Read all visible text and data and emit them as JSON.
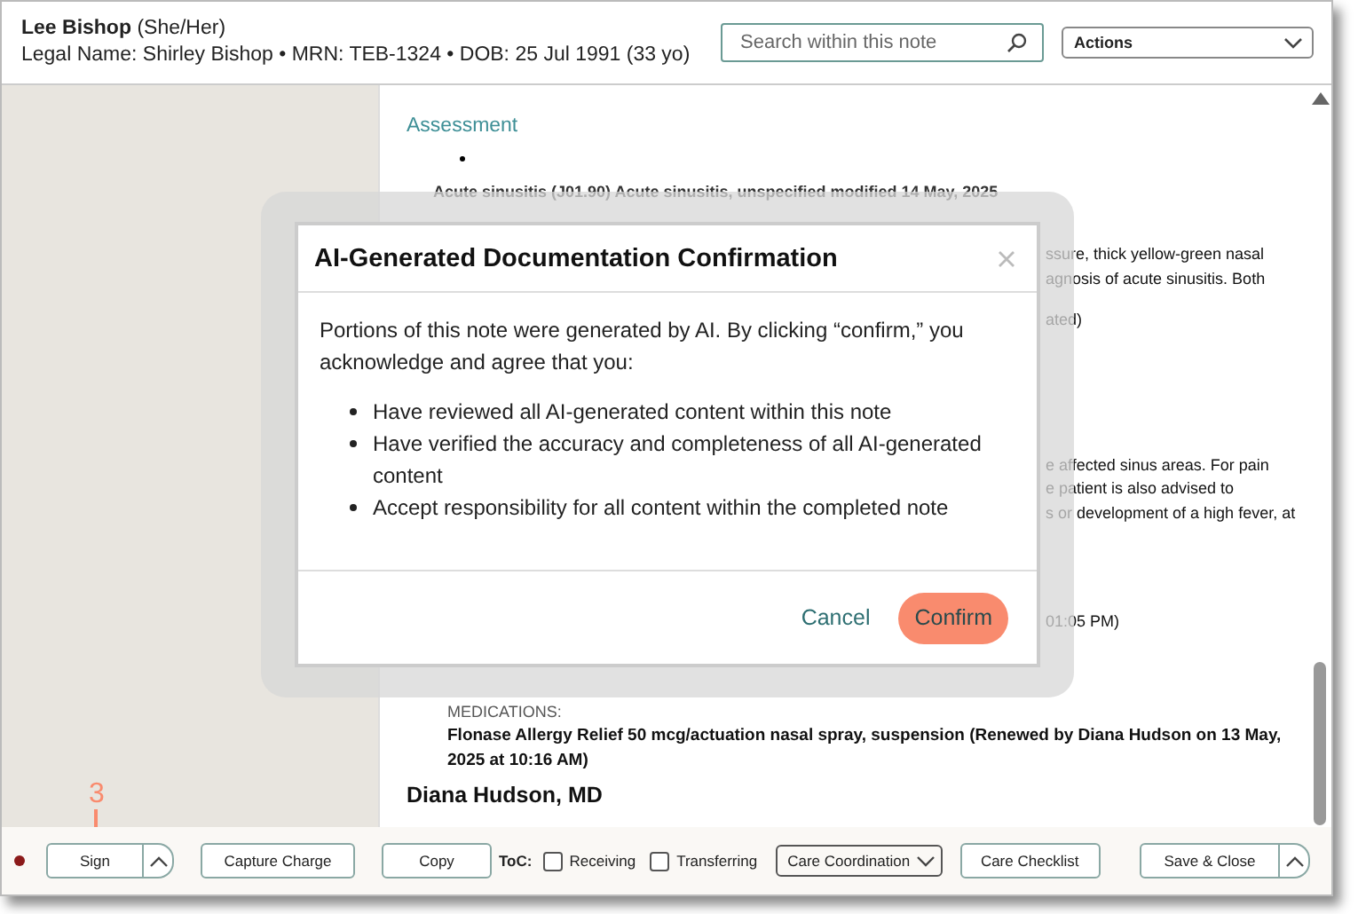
{
  "patient": {
    "name": "Lee Bishop",
    "pronouns": "(She/Her)",
    "details": "Legal Name: Shirley Bishop • MRN: TEB-1324 • DOB: 25 Jul 1991 (33 yo)"
  },
  "search": {
    "placeholder": "Search within this note"
  },
  "actions_dropdown": {
    "value": "Actions"
  },
  "note": {
    "section_heading": "Assessment",
    "diagnosis": "Acute sinusitis (J01.90) Acute sinusitis, unspecified modified 14 May, 2025",
    "fragments": [
      {
        "lines": [
          "ssure, thick yellow-green nasal",
          "agnosis of acute sinusitis. Both"
        ]
      },
      {
        "lines": [
          "ated)"
        ]
      },
      {
        "lines": [
          "e affected sinus areas. For pain",
          "e patient is also advised to",
          "s or development of a high fever, at"
        ]
      },
      {
        "lines": [
          "01:05 PM)"
        ]
      }
    ],
    "medications_label": "MEDICATIONS:",
    "medication": "Flonase Allergy Relief 50 mcg/actuation nasal spray, suspension (Renewed by Diana Hudson on 13 May, 2025 at 10:16 AM)",
    "signature": "Diana Hudson, MD"
  },
  "dialog": {
    "title": "AI-Generated Documentation Confirmation",
    "intro": "Portions of this note were generated by AI. By clicking “confirm,” you acknowledge and agree that you:",
    "points": [
      "Have reviewed all AI-generated content within this note",
      "Have verified the accuracy and completeness of all AI-generated content",
      "Accept responsibility for all content within the completed note"
    ],
    "buttons": [
      {
        "label": "Cancel",
        "kind": "link"
      },
      {
        "label": "Confirm",
        "kind": "primary"
      }
    ]
  },
  "callout": "3",
  "footer": {
    "sign": "Sign",
    "capture_charge": "Capture Charge",
    "copy": "Copy",
    "toc_label": "ToC:",
    "checkboxes": [
      {
        "label": "Receiving",
        "checked": false
      },
      {
        "label": "Transferring",
        "checked": false
      }
    ],
    "care_dropdown": "Care Coordination",
    "care_checklist": "Care Checklist",
    "save_close": "Save & Close"
  }
}
